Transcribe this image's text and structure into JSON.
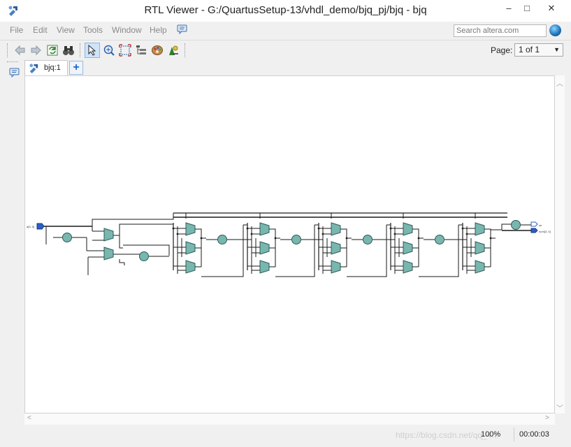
{
  "window": {
    "title": "RTL Viewer - G:/QuartusSetup-13/vhdl_demo/bjq_pj/bjq - bjq",
    "minimize": "–",
    "maximize": "□",
    "close": "✕"
  },
  "menu": [
    "File",
    "Edit",
    "View",
    "Tools",
    "Window",
    "Help"
  ],
  "search": {
    "placeholder": "Search altera.com"
  },
  "toolbar": {
    "page_label": "Page:",
    "page_value": "1 of 1"
  },
  "tab": {
    "label": "bjq:1"
  },
  "schematic": {
    "input_port": "a[3..0]",
    "output_port_1": "se",
    "output_port_2": "num[3..0]"
  },
  "status": {
    "zoom": "100%",
    "time": "00:00:03",
    "watermark": "https://blog.csdn.net/qq_4..."
  }
}
